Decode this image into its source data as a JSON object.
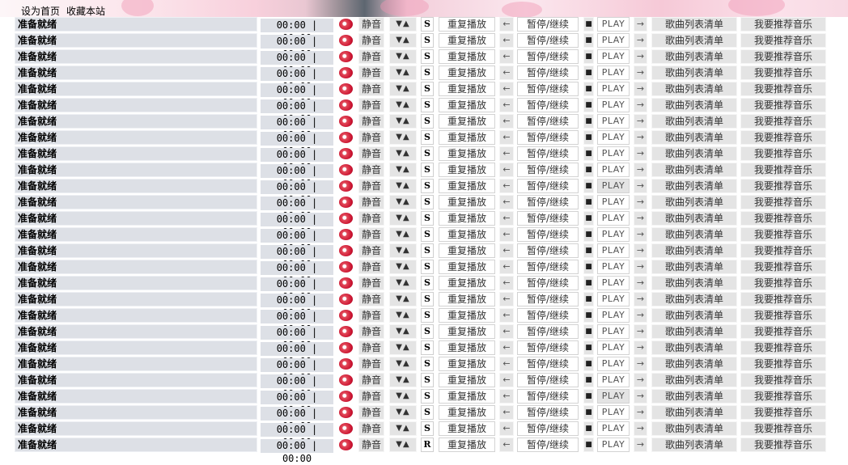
{
  "header": {
    "links": [
      "设为首页",
      "收藏本站"
    ]
  },
  "rows": [
    {
      "status": "准备就绪",
      "time": "00:00 | 00:00",
      "mute": "静音",
      "volume": "▼▲",
      "mode": "S",
      "repeat": "重复播放",
      "prev": "←",
      "pause": "暂停/继续",
      "stop": "■",
      "play": "PLAY",
      "next": "→",
      "songlist": "歌曲列表清单",
      "recommend": "我要推荐音乐"
    },
    {
      "status": "准备就绪",
      "time": "00:00 | 00:00",
      "mute": "静音",
      "volume": "▼▲",
      "mode": "S",
      "repeat": "重复播放",
      "prev": "←",
      "pause": "暂停/继续",
      "stop": "■",
      "play": "PLAY",
      "next": "→",
      "songlist": "歌曲列表清单",
      "recommend": "我要推荐音乐"
    },
    {
      "status": "准备就绪",
      "time": "00:00 | 00:00",
      "mute": "静音",
      "volume": "▼▲",
      "mode": "S",
      "repeat": "重复播放",
      "prev": "←",
      "pause": "暂停/继续",
      "stop": "■",
      "play": "PLAY",
      "next": "→",
      "songlist": "歌曲列表清单",
      "recommend": "我要推荐音乐"
    },
    {
      "status": "准备就绪",
      "time": "00:00 | 00:00",
      "mute": "静音",
      "volume": "▼▲",
      "mode": "S",
      "repeat": "重复播放",
      "prev": "←",
      "pause": "暂停/继续",
      "stop": "■",
      "play": "PLAY",
      "next": "→",
      "songlist": "歌曲列表清单",
      "recommend": "我要推荐音乐"
    },
    {
      "status": "准备就绪",
      "time": "00:00 | 00:00",
      "mute": "静音",
      "volume": "▼▲",
      "mode": "S",
      "repeat": "重复播放",
      "prev": "←",
      "pause": "暂停/继续",
      "stop": "■",
      "play": "PLAY",
      "next": "→",
      "songlist": "歌曲列表清单",
      "recommend": "我要推荐音乐"
    },
    {
      "status": "准备就绪",
      "time": "00:00 | 00:00",
      "mute": "静音",
      "volume": "▼▲",
      "mode": "S",
      "repeat": "重复播放",
      "prev": "←",
      "pause": "暂停/继续",
      "stop": "■",
      "play": "PLAY",
      "next": "→",
      "songlist": "歌曲列表清单",
      "recommend": "我要推荐音乐"
    },
    {
      "status": "准备就绪",
      "time": "00:00 | 00:00",
      "mute": "静音",
      "volume": "▼▲",
      "mode": "S",
      "repeat": "重复播放",
      "prev": "←",
      "pause": "暂停/继续",
      "stop": "■",
      "play": "PLAY",
      "next": "→",
      "songlist": "歌曲列表清单",
      "recommend": "我要推荐音乐"
    },
    {
      "status": "准备就绪",
      "time": "00:00 | 00:00",
      "mute": "静音",
      "volume": "▼▲",
      "mode": "S",
      "repeat": "重复播放",
      "prev": "←",
      "pause": "暂停/继续",
      "stop": "■",
      "play": "PLAY",
      "next": "→",
      "songlist": "歌曲列表清单",
      "recommend": "我要推荐音乐"
    },
    {
      "status": "准备就绪",
      "time": "00:00 | 00:00",
      "mute": "静音",
      "volume": "▼▲",
      "mode": "S",
      "repeat": "重复播放",
      "prev": "←",
      "pause": "暂停/继续",
      "stop": "■",
      "play": "PLAY",
      "next": "→",
      "songlist": "歌曲列表清单",
      "recommend": "我要推荐音乐"
    },
    {
      "status": "准备就绪",
      "time": "00:00 | 00:00",
      "mute": "静音",
      "volume": "▼▲",
      "mode": "S",
      "repeat": "重复播放",
      "prev": "←",
      "pause": "暂停/继续",
      "stop": "■",
      "play": "PLAY",
      "next": "→",
      "songlist": "歌曲列表清单",
      "recommend": "我要推荐音乐"
    },
    {
      "status": "准备就绪",
      "time": "00:00 | 00:00",
      "mute": "静音",
      "volume": "▼▲",
      "mode": "S",
      "repeat": "重复播放",
      "prev": "←",
      "pause": "暂停/继续",
      "stop": "■",
      "play": "PLAY",
      "next": "→",
      "songlist": "歌曲列表清单",
      "recommend": "我要推荐音乐",
      "play_highlighted": true
    },
    {
      "status": "准备就绪",
      "time": "00:00 | 00:00",
      "mute": "静音",
      "volume": "▼▲",
      "mode": "S",
      "repeat": "重复播放",
      "prev": "←",
      "pause": "暂停/继续",
      "stop": "■",
      "play": "PLAY",
      "next": "→",
      "songlist": "歌曲列表清单",
      "recommend": "我要推荐音乐"
    },
    {
      "status": "准备就绪",
      "time": "00:00 | 00:00",
      "mute": "静音",
      "volume": "▼▲",
      "mode": "S",
      "repeat": "重复播放",
      "prev": "←",
      "pause": "暂停/继续",
      "stop": "■",
      "play": "PLAY",
      "next": "→",
      "songlist": "歌曲列表清单",
      "recommend": "我要推荐音乐"
    },
    {
      "status": "准备就绪",
      "time": "00:00 | 00:00",
      "mute": "静音",
      "volume": "▼▲",
      "mode": "S",
      "repeat": "重复播放",
      "prev": "←",
      "pause": "暂停/继续",
      "stop": "■",
      "play": "PLAY",
      "next": "→",
      "songlist": "歌曲列表清单",
      "recommend": "我要推荐音乐"
    },
    {
      "status": "准备就绪",
      "time": "00:00 | 00:00",
      "mute": "静音",
      "volume": "▼▲",
      "mode": "S",
      "repeat": "重复播放",
      "prev": "←",
      "pause": "暂停/继续",
      "stop": "■",
      "play": "PLAY",
      "next": "→",
      "songlist": "歌曲列表清单",
      "recommend": "我要推荐音乐"
    },
    {
      "status": "准备就绪",
      "time": "00:00 | 00:00",
      "mute": "静音",
      "volume": "▼▲",
      "mode": "S",
      "repeat": "重复播放",
      "prev": "←",
      "pause": "暂停/继续",
      "stop": "■",
      "play": "PLAY",
      "next": "→",
      "songlist": "歌曲列表清单",
      "recommend": "我要推荐音乐"
    },
    {
      "status": "准备就绪",
      "time": "00:00 | 00:00",
      "mute": "静音",
      "volume": "▼▲",
      "mode": "S",
      "repeat": "重复播放",
      "prev": "←",
      "pause": "暂停/继续",
      "stop": "■",
      "play": "PLAY",
      "next": "→",
      "songlist": "歌曲列表清单",
      "recommend": "我要推荐音乐"
    },
    {
      "status": "准备就绪",
      "time": "00:00 | 00:00",
      "mute": "静音",
      "volume": "▼▲",
      "mode": "S",
      "repeat": "重复播放",
      "prev": "←",
      "pause": "暂停/继续",
      "stop": "■",
      "play": "PLAY",
      "next": "→",
      "songlist": "歌曲列表清单",
      "recommend": "我要推荐音乐"
    },
    {
      "status": "准备就绪",
      "time": "00:00 | 00:00",
      "mute": "静音",
      "volume": "▼▲",
      "mode": "S",
      "repeat": "重复播放",
      "prev": "←",
      "pause": "暂停/继续",
      "stop": "■",
      "play": "PLAY",
      "next": "→",
      "songlist": "歌曲列表清单",
      "recommend": "我要推荐音乐"
    },
    {
      "status": "准备就绪",
      "time": "00:00 | 00:00",
      "mute": "静音",
      "volume": "▼▲",
      "mode": "S",
      "repeat": "重复播放",
      "prev": "←",
      "pause": "暂停/继续",
      "stop": "■",
      "play": "PLAY",
      "next": "→",
      "songlist": "歌曲列表清单",
      "recommend": "我要推荐音乐"
    },
    {
      "status": "准备就绪",
      "time": "00:00 | 00:00",
      "mute": "静音",
      "volume": "▼▲",
      "mode": "S",
      "repeat": "重复播放",
      "prev": "←",
      "pause": "暂停/继续",
      "stop": "■",
      "play": "PLAY",
      "next": "→",
      "songlist": "歌曲列表清单",
      "recommend": "我要推荐音乐"
    },
    {
      "status": "准备就绪",
      "time": "00:00 | 00:00",
      "mute": "静音",
      "volume": "▼▲",
      "mode": "S",
      "repeat": "重复播放",
      "prev": "←",
      "pause": "暂停/继续",
      "stop": "■",
      "play": "PLAY",
      "next": "→",
      "songlist": "歌曲列表清单",
      "recommend": "我要推荐音乐"
    },
    {
      "status": "准备就绪",
      "time": "00:00 | 00:00",
      "mute": "静音",
      "volume": "▼▲",
      "mode": "S",
      "repeat": "重复播放",
      "prev": "←",
      "pause": "暂停/继续",
      "stop": "■",
      "play": "PLAY",
      "next": "→",
      "songlist": "歌曲列表清单",
      "recommend": "我要推荐音乐"
    },
    {
      "status": "准备就绪",
      "time": "00:00 | 00:00",
      "mute": "静音",
      "volume": "▼▲",
      "mode": "S",
      "repeat": "重复播放",
      "prev": "←",
      "pause": "暂停/继续",
      "stop": "■",
      "play": "PLAY",
      "next": "→",
      "songlist": "歌曲列表清单",
      "recommend": "我要推荐音乐",
      "play_highlighted": true
    },
    {
      "status": "准备就绪",
      "time": "00:00 | 00:00",
      "mute": "静音",
      "volume": "▼▲",
      "mode": "S",
      "repeat": "重复播放",
      "prev": "←",
      "pause": "暂停/继续",
      "stop": "■",
      "play": "PLAY",
      "next": "→",
      "songlist": "歌曲列表清单",
      "recommend": "我要推荐音乐"
    },
    {
      "status": "准备就绪",
      "time": "00:00 | 00:00",
      "mute": "静音",
      "volume": "▼▲",
      "mode": "S",
      "repeat": "重复播放",
      "prev": "←",
      "pause": "暂停/继续",
      "stop": "■",
      "play": "PLAY",
      "next": "→",
      "songlist": "歌曲列表清单",
      "recommend": "我要推荐音乐"
    },
    {
      "status": "准备就绪",
      "time": "00:00 | 00:00",
      "mute": "静音",
      "volume": "▼▲",
      "mode": "R",
      "repeat": "重复播放",
      "prev": "←",
      "pause": "暂停/继续",
      "stop": "■",
      "play": "PLAY",
      "next": "→",
      "songlist": "歌曲列表清单",
      "recommend": "我要推荐音乐"
    }
  ],
  "colors": {
    "status_bg": "#dde0e6",
    "button_bg": "#e4e4e4",
    "disc_red": "#c8102e",
    "banner_pink": "#f8d0dc"
  }
}
